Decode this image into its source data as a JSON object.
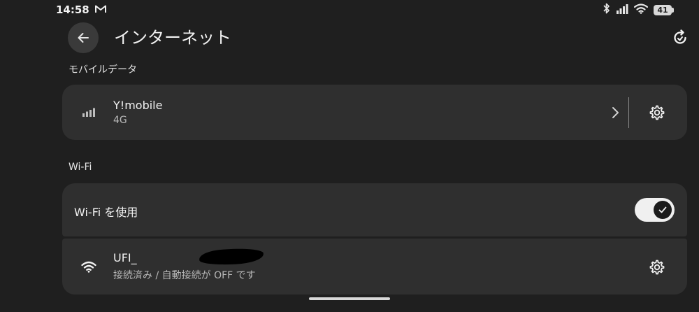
{
  "status_bar": {
    "time": "14:58",
    "notification_icon": "gmail-icon",
    "battery_level": "41",
    "icons": [
      "bluetooth-icon",
      "signal-icon",
      "wifi-icon",
      "battery-icon"
    ]
  },
  "header": {
    "title": "インターネット",
    "back_icon": "back-arrow-icon",
    "action_icon": "refresh-icon"
  },
  "mobile_data": {
    "section_label": "モバイルデータ",
    "carrier": "Y!mobile",
    "network_type": "4G"
  },
  "wifi": {
    "section_label": "Wi-Fi",
    "toggle_label": "Wi-Fi を使用",
    "toggle_on": true,
    "network": {
      "ssid": "UFI_",
      "status": "接続済み / 自動接続が OFF です"
    }
  },
  "colors": {
    "background": "#1f1f1f",
    "card": "#2f2f2f",
    "toggle_track": "#f0f0f0",
    "toggle_knob": "#1c1c1c"
  }
}
